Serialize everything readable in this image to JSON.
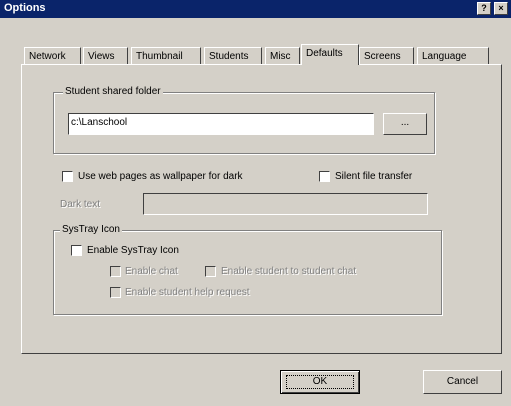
{
  "window": {
    "title": "Options",
    "help_glyph": "?",
    "close_glyph": "×"
  },
  "tabs": [
    {
      "label": "Network",
      "active": false
    },
    {
      "label": "Views",
      "active": false
    },
    {
      "label": "Thumbnail",
      "active": false
    },
    {
      "label": "Students",
      "active": false
    },
    {
      "label": "Misc",
      "active": false
    },
    {
      "label": "Defaults",
      "active": true
    },
    {
      "label": "Screens",
      "active": false
    },
    {
      "label": "Language",
      "active": false
    }
  ],
  "shared_folder": {
    "legend": "Student shared folder",
    "path_value": "c:\\Lanschool",
    "browse_label": "..."
  },
  "options": {
    "web_wallpaper_label": "Use web pages as wallpaper for dark",
    "silent_transfer_label": "Silent file transfer"
  },
  "dark_text": {
    "label": "Dark text",
    "value": ""
  },
  "systray": {
    "legend": "SysTray Icon",
    "enable_icon_label": "Enable SysTray Icon",
    "enable_chat_label": "Enable chat",
    "enable_student_chat_label": "Enable student to student chat",
    "enable_help_request_label": "Enable student help request"
  },
  "footer": {
    "ok_label": "OK",
    "cancel_label": "Cancel"
  }
}
